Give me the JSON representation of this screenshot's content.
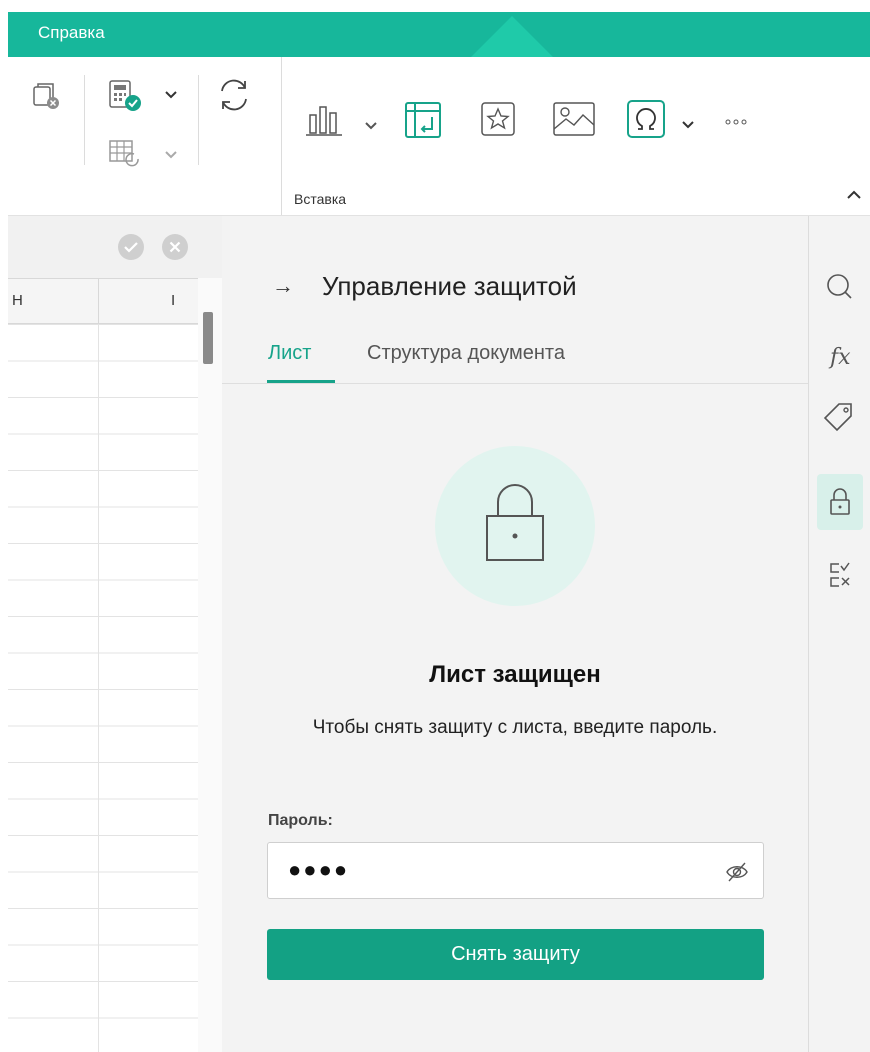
{
  "menu": {
    "tab_help": "Справка"
  },
  "ribbon": {
    "group_insert_label": "Вставка",
    "more_label": "···"
  },
  "sheet": {
    "columns": [
      "H",
      "I"
    ]
  },
  "panel": {
    "back_arrow": "→",
    "title": "Управление защитой",
    "tabs": [
      {
        "label": "Лист",
        "active": true
      },
      {
        "label": "Структура документа",
        "active": false
      }
    ],
    "status_title": "Лист защищен",
    "status_desc": "Чтобы снять защиту с листа, введите пароль.",
    "password_label": "Пароль:",
    "password_value": "●●●●",
    "unprotect_button": "Снять защиту"
  },
  "side_toolbar": {
    "items": [
      "search-icon",
      "function-icon",
      "tag-icon",
      "lock-icon",
      "check-list-icon"
    ],
    "active": "lock-icon"
  },
  "colors": {
    "accent": "#17a38a",
    "topbar": "#17b79b",
    "button": "#13a184",
    "lock_circle": "#e1f4ef"
  }
}
